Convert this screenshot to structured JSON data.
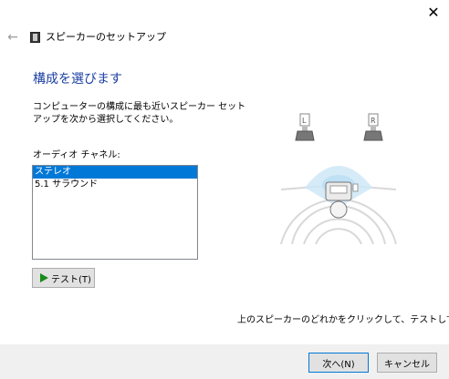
{
  "window": {
    "title": "スピーカーのセットアップ",
    "close_icon": "close-icon",
    "back_icon": "back-arrow-icon"
  },
  "main": {
    "heading": "構成を選びます",
    "description": "コンピューターの構成に最も近いスピーカー セットアップを次から選択してください。",
    "channels_label": "オーディオ チャネル:",
    "channels": [
      {
        "label": "ステレオ",
        "selected": true
      },
      {
        "label": "5.1 サラウンド",
        "selected": false
      }
    ],
    "test_button": "テスト(T)",
    "speaker_left_label": "L",
    "speaker_right_label": "R",
    "hint": "上のスピーカーのどれかをクリックして、テストしてくださ"
  },
  "footer": {
    "next_button": "次へ(N)",
    "cancel_button": "キャンセル"
  },
  "colors": {
    "heading": "#1c3fa3",
    "selection": "#0078d7",
    "play": "#1a8a1a",
    "footer_bg": "#f0f0f0"
  }
}
